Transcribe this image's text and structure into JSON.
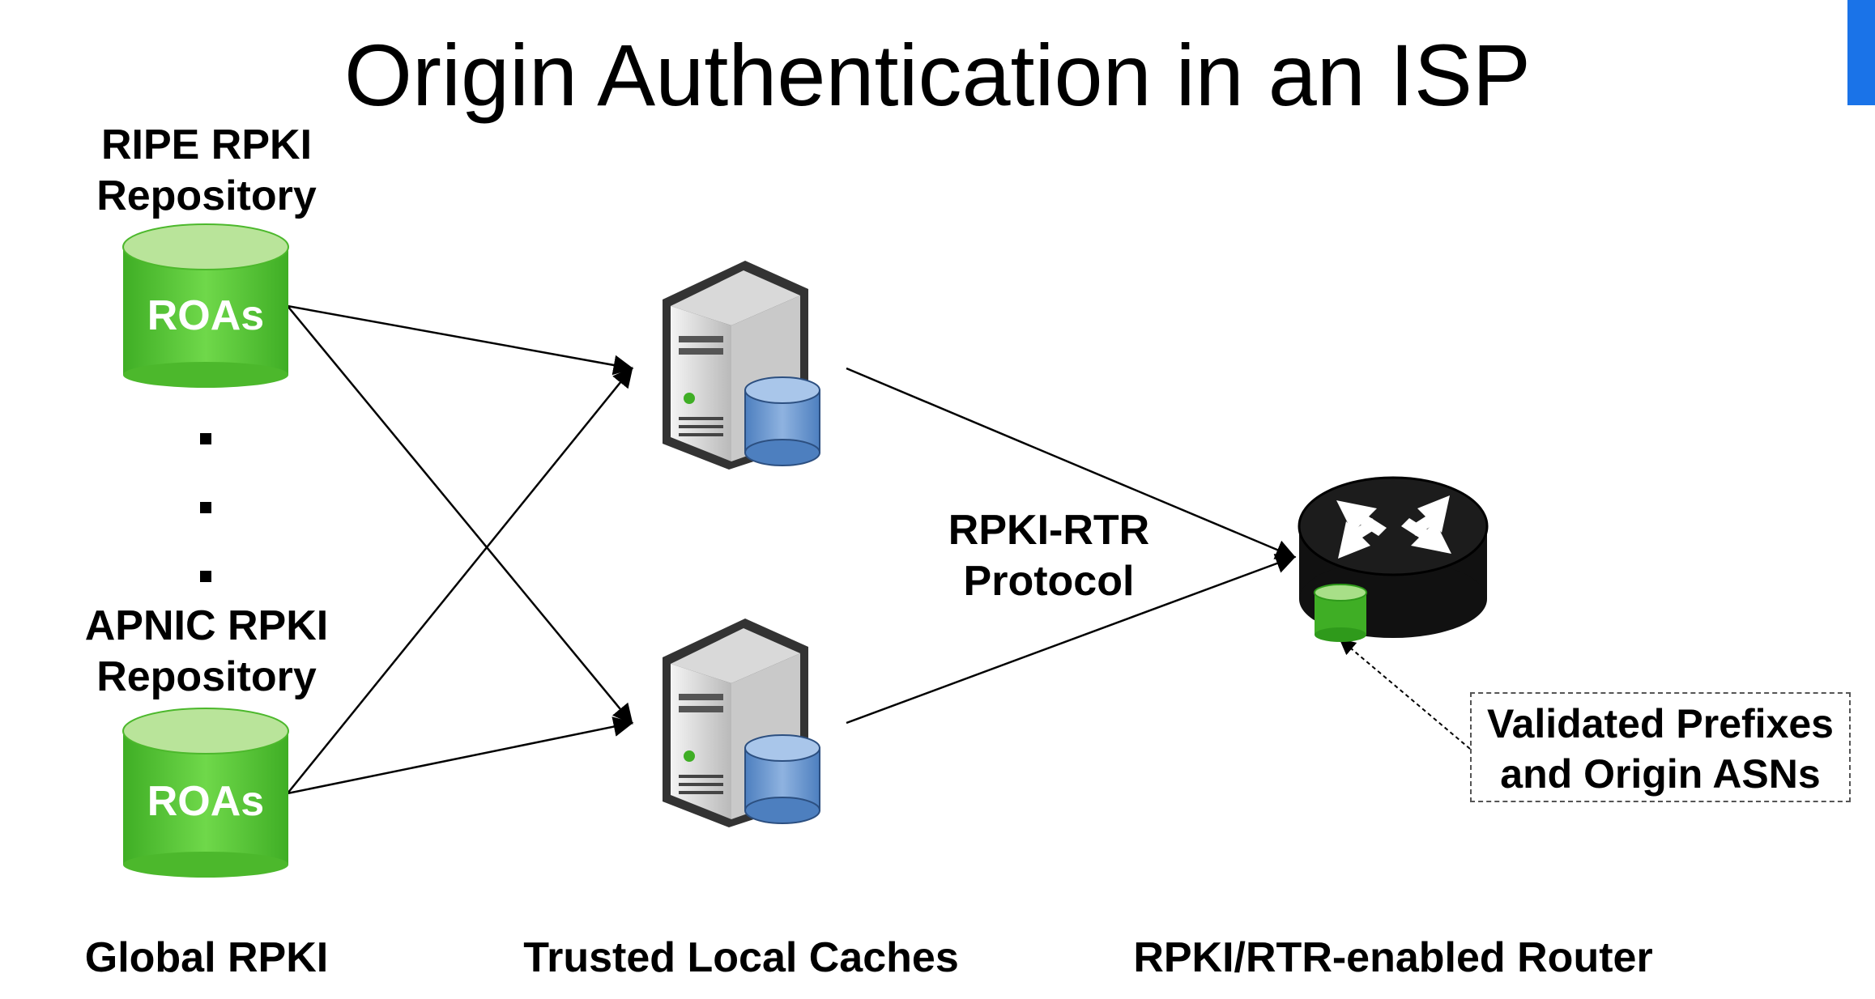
{
  "title": "Origin Authentication in an ISP",
  "repositories": {
    "ripe_line1": "RIPE RPKI",
    "ripe_line2": "Repository",
    "apnic_line1": "APNIC RPKI",
    "apnic_line2": "Repository",
    "db_label": "ROAs"
  },
  "protocol": {
    "line1": "RPKI-RTR",
    "line2": "Protocol"
  },
  "validated": {
    "line1": "Validated Prefixes",
    "line2": "and Origin ASNs"
  },
  "columns": {
    "global": "Global RPKI",
    "caches": "Trusted Local Caches",
    "router": "RPKI/RTR-enabled Router"
  },
  "colors": {
    "db_green": "#5cc83a",
    "db_top": "#b9e49a",
    "accent_blue": "#1a73e8",
    "cylinder_blue": "#6b98cf",
    "router_black": "#111111"
  }
}
